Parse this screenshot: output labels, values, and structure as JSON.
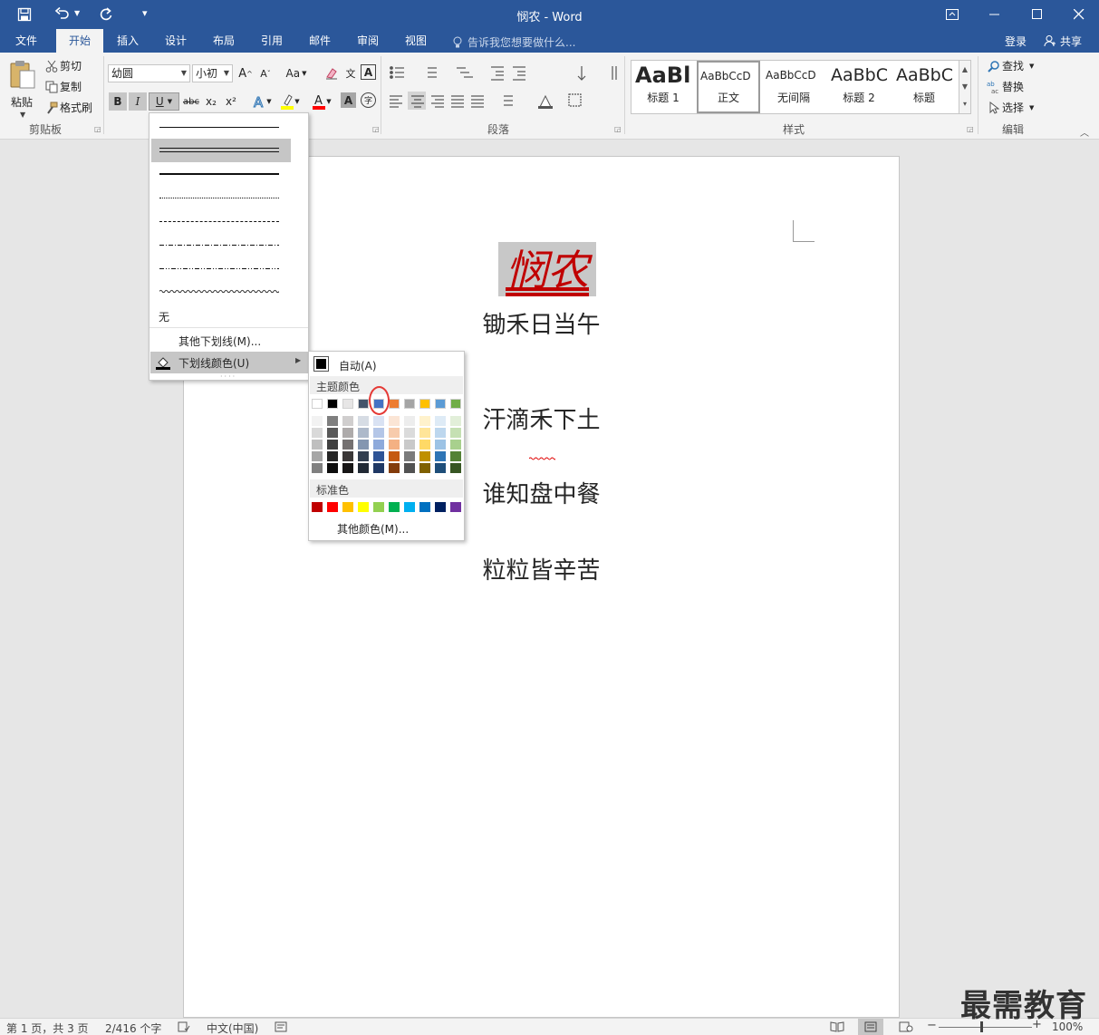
{
  "window": {
    "title": "悯农 - Word"
  },
  "tabs": [
    "文件",
    "开始",
    "插入",
    "设计",
    "布局",
    "引用",
    "邮件",
    "审阅",
    "视图"
  ],
  "tell_me": "告诉我您想要做什么...",
  "account": {
    "login": "登录",
    "share": "共享"
  },
  "clipboard": {
    "paste": "粘贴",
    "cut": "剪切",
    "copy": "复制",
    "format_painter": "格式刷",
    "label": "剪贴板"
  },
  "font": {
    "name": "幼圆",
    "size": "小初",
    "change_case": "Aa"
  },
  "format": {
    "bold": "B",
    "italic": "I",
    "underline": "U",
    "strike": "abc",
    "sub": "x₂",
    "sup": "x²",
    "char_border": "A",
    "char_shade": "A",
    "phonetic": "文",
    "enclose": "字"
  },
  "paragraph": {
    "label": "段落"
  },
  "styles": {
    "label": "样式",
    "items": [
      {
        "preview": "AaBl",
        "name": "标题 1"
      },
      {
        "preview": "AaBbCcD",
        "name": "正文"
      },
      {
        "preview": "AaBbCcD",
        "name": "无间隔"
      },
      {
        "preview": "AaBbC",
        "name": "标题 2"
      },
      {
        "preview": "AaBbC",
        "name": "标题"
      }
    ]
  },
  "editing": {
    "find": "查找",
    "replace": "替换",
    "select": "选择",
    "label": "编辑"
  },
  "underline_menu": {
    "none": "无",
    "more": "其他下划线(M)...",
    "color": "下划线颜色(U)"
  },
  "color_menu": {
    "auto": "自动(A)",
    "theme_header": "主题颜色",
    "standard_header": "标准色",
    "more": "其他颜色(M)...",
    "theme_top": [
      "#ffffff",
      "#000000",
      "#e7e6e6",
      "#44546a",
      "#4472c4",
      "#ed7d31",
      "#a5a5a5",
      "#ffc000",
      "#5b9bd5",
      "#70ad47"
    ],
    "theme_shades": [
      [
        "#f2f2f2",
        "#d9d9d9",
        "#bfbfbf",
        "#a6a6a6",
        "#808080"
      ],
      [
        "#7f7f7f",
        "#595959",
        "#404040",
        "#262626",
        "#0d0d0d"
      ],
      [
        "#d0cece",
        "#aeabab",
        "#757171",
        "#3b3838",
        "#171616"
      ],
      [
        "#d6dce4",
        "#adb9ca",
        "#8496b0",
        "#333f4f",
        "#222a35"
      ],
      [
        "#d9e2f3",
        "#b4c6e7",
        "#8eaadb",
        "#2f5496",
        "#1f3864"
      ],
      [
        "#fbe5d5",
        "#f7cbac",
        "#f4b183",
        "#c55a11",
        "#833c0b"
      ],
      [
        "#ededed",
        "#dbdbdb",
        "#c9c9c9",
        "#7b7b7b",
        "#525252"
      ],
      [
        "#fff2cc",
        "#ffe599",
        "#ffd966",
        "#bf9000",
        "#7f6000"
      ],
      [
        "#deebf6",
        "#bdd7ee",
        "#9cc3e5",
        "#2e75b5",
        "#1e4e79"
      ],
      [
        "#e2efd9",
        "#c5e0b3",
        "#a8d08d",
        "#538135",
        "#375623"
      ]
    ],
    "standard": [
      "#c00000",
      "#ff0000",
      "#ffc000",
      "#ffff00",
      "#92d050",
      "#00b050",
      "#00b0f0",
      "#0070c0",
      "#002060",
      "#7030a0"
    ]
  },
  "document": {
    "title": "悯农",
    "lines": [
      "锄禾日当午",
      "汗滴禾下土",
      "谁知盘中餐",
      "粒粒皆辛苦"
    ]
  },
  "status": {
    "page": "第 1 页，共 3 页",
    "words": "2/416 个字",
    "lang": "中文(中国)",
    "zoom": "100%"
  },
  "watermark": "最需教育"
}
